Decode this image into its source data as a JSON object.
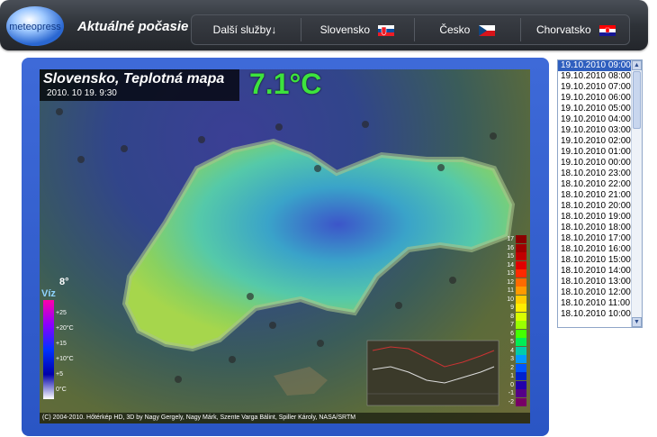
{
  "header": {
    "logo_text": "meteopress",
    "title": "Aktuálné počasie",
    "nav": [
      {
        "label": "Další služby",
        "arrow": "↓"
      },
      {
        "label": "Slovensko",
        "flag": "sk"
      },
      {
        "label": "Česko",
        "flag": "cz"
      },
      {
        "label": "Chorvatsko",
        "flag": "hr"
      }
    ]
  },
  "map": {
    "title": "Slovensko, Teplotná mapa",
    "datetime": "2010. 10 19. 9:30",
    "temperature": "7.1°C",
    "copyright": "(C) 2004-2010. Hőtérkép HD, 3D by Nagy Gergely, Nagy Márk, Szente Varga Bálint, Spiller Károly, NASA/SRTM",
    "legend_left": {
      "label": "Víz",
      "current": "8°",
      "ticks": [
        "+25",
        "+20°C",
        "+15",
        "+10°C",
        "+5",
        "0°C"
      ]
    },
    "legend_right": [
      "17",
      "16",
      "15",
      "14",
      "13",
      "12",
      "11",
      "10",
      "9",
      "8",
      "7",
      "6",
      "5",
      "4",
      "3",
      "2",
      "1",
      "0",
      "-1",
      "-2"
    ]
  },
  "timelist": {
    "items": [
      "19.10.2010 09:00",
      "19.10.2010 08:00",
      "19.10.2010 07:00",
      "19.10.2010 06:00",
      "19.10.2010 05:00",
      "19.10.2010 04:00",
      "19.10.2010 03:00",
      "19.10.2010 02:00",
      "19.10.2010 01:00",
      "19.10.2010 00:00",
      "18.10.2010 23:00",
      "18.10.2010 22:00",
      "18.10.2010 21:00",
      "18.10.2010 20:00",
      "18.10.2010 19:00",
      "18.10.2010 18:00",
      "18.10.2010 17:00",
      "18.10.2010 16:00",
      "18.10.2010 15:00",
      "18.10.2010 14:00",
      "18.10.2010 13:00",
      "18.10.2010 12:00",
      "18.10.2010 11:00",
      "18.10.2010 10:00"
    ],
    "selected_index": 0
  },
  "colors": {
    "temp_green": "#3de33d",
    "panel_blue": "#2f5fbf",
    "header_dark": "#2e3238"
  }
}
